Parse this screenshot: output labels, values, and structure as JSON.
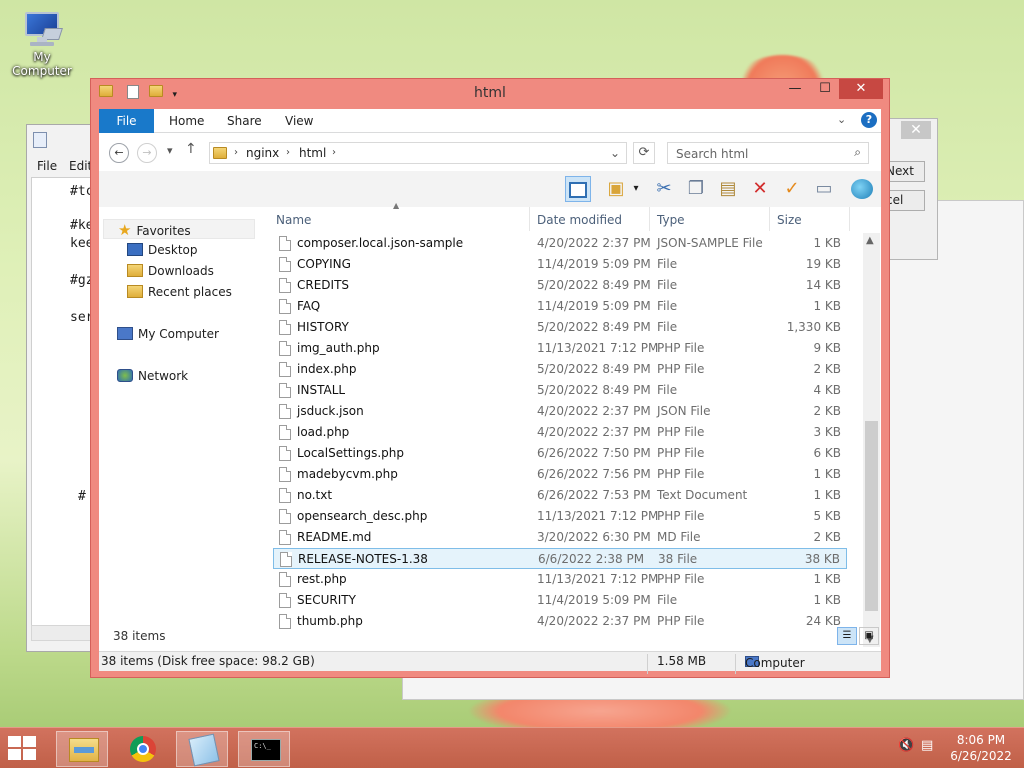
{
  "desktop": {
    "icons": [
      {
        "label": "My Computer"
      }
    ]
  },
  "notepad": {
    "menu": [
      "File",
      "Edit"
    ],
    "lines": [
      "#tc",
      "#ke",
      "kee",
      "#gz",
      "ser",
      "#"
    ]
  },
  "wizard": {
    "next_label": "Next",
    "cancel_label": "cel"
  },
  "window": {
    "title": "html",
    "controls": {
      "minimize": "—",
      "maximize": "☐",
      "close": "✕"
    }
  },
  "ribbon": {
    "file_tab": "File",
    "tabs": [
      "Home",
      "Share",
      "View"
    ]
  },
  "address": {
    "path": [
      "nginx",
      "html"
    ],
    "search_placeholder": "Search html"
  },
  "nav_pane": {
    "favorites": "Favorites",
    "favorite_items": [
      "Desktop",
      "Downloads",
      "Recent places"
    ],
    "computer": "My Computer",
    "network": "Network"
  },
  "columns": {
    "name": "Name",
    "date": "Date modified",
    "type": "Type",
    "size": "Size"
  },
  "files": [
    {
      "name": "composer.local.json-sample",
      "date": "4/20/2022 2:37 PM",
      "type": "JSON-SAMPLE File",
      "size": "1 KB"
    },
    {
      "name": "COPYING",
      "date": "11/4/2019 5:09 PM",
      "type": "File",
      "size": "19 KB"
    },
    {
      "name": "CREDITS",
      "date": "5/20/2022 8:49 PM",
      "type": "File",
      "size": "14 KB"
    },
    {
      "name": "FAQ",
      "date": "11/4/2019 5:09 PM",
      "type": "File",
      "size": "1 KB"
    },
    {
      "name": "HISTORY",
      "date": "5/20/2022 8:49 PM",
      "type": "File",
      "size": "1,330 KB"
    },
    {
      "name": "img_auth.php",
      "date": "11/13/2021 7:12 PM",
      "type": "PHP File",
      "size": "9 KB"
    },
    {
      "name": "index.php",
      "date": "5/20/2022 8:49 PM",
      "type": "PHP File",
      "size": "2 KB"
    },
    {
      "name": "INSTALL",
      "date": "5/20/2022 8:49 PM",
      "type": "File",
      "size": "4 KB"
    },
    {
      "name": "jsduck.json",
      "date": "4/20/2022 2:37 PM",
      "type": "JSON File",
      "size": "2 KB"
    },
    {
      "name": "load.php",
      "date": "4/20/2022 2:37 PM",
      "type": "PHP File",
      "size": "3 KB"
    },
    {
      "name": "LocalSettings.php",
      "date": "6/26/2022 7:50 PM",
      "type": "PHP File",
      "size": "6 KB"
    },
    {
      "name": "madebycvm.php",
      "date": "6/26/2022 7:56 PM",
      "type": "PHP File",
      "size": "1 KB"
    },
    {
      "name": "no.txt",
      "date": "6/26/2022 7:53 PM",
      "type": "Text Document",
      "size": "1 KB"
    },
    {
      "name": "opensearch_desc.php",
      "date": "11/13/2021 7:12 PM",
      "type": "PHP File",
      "size": "5 KB"
    },
    {
      "name": "README.md",
      "date": "3/20/2022 6:30 PM",
      "type": "MD File",
      "size": "2 KB"
    },
    {
      "name": "RELEASE-NOTES-1.38",
      "date": "6/6/2022 2:38 PM",
      "type": "38 File",
      "size": "38 KB",
      "selected": true
    },
    {
      "name": "rest.php",
      "date": "11/13/2021 7:12 PM",
      "type": "PHP File",
      "size": "1 KB"
    },
    {
      "name": "SECURITY",
      "date": "11/4/2019 5:09 PM",
      "type": "File",
      "size": "1 KB"
    },
    {
      "name": "thumb.php",
      "date": "4/20/2022 2:37 PM",
      "type": "PHP File",
      "size": "24 KB"
    }
  ],
  "item_count": "38 items",
  "status": {
    "left": "38 items (Disk free space: 98.2 GB)",
    "size": "1.58 MB",
    "location": "Computer"
  },
  "taskbar": {
    "time": "8:06 PM",
    "date": "6/26/2022",
    "cmd_text": "C:\\_"
  },
  "colors": {
    "window_frame": "#f08a80",
    "file_tab": "#1979ca",
    "selection": "#e5f3fb",
    "taskbar": "#c96650"
  }
}
